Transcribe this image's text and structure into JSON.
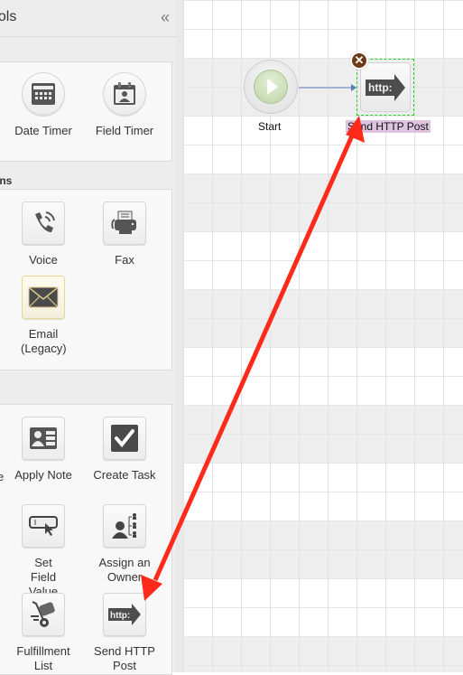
{
  "sidebar": {
    "title": "ools",
    "collapse_icon": "«",
    "sections": [
      {
        "heading": "",
        "tools": [
          {
            "label": "Date Timer",
            "icon": "calendar-icon"
          },
          {
            "label": "Field Timer",
            "icon": "contact-calendar-icon"
          }
        ]
      },
      {
        "heading": "ons",
        "tools": [
          {
            "label": "Voice",
            "icon": "phone-icon"
          },
          {
            "label": "Fax",
            "icon": "fax-icon"
          },
          {
            "label": "Email (Legacy)",
            "icon": "envelope-icon"
          }
        ]
      },
      {
        "heading": "",
        "cut_label": "e",
        "tools": [
          {
            "label": "Apply Note",
            "icon": "contact-card-icon"
          },
          {
            "label": "Create Task",
            "icon": "checkbox-icon"
          },
          {
            "label": "Set Field Value",
            "icon": "field-cursor-icon"
          },
          {
            "label": "Assign an Owner",
            "icon": "org-chart-person-icon"
          },
          {
            "label": "Fulfillment List",
            "icon": "hand-truck-icon"
          },
          {
            "label": "Send HTTP Post",
            "icon": "http-arrow-icon"
          }
        ]
      }
    ]
  },
  "canvas": {
    "nodes": [
      {
        "label": "Start",
        "type": "start"
      },
      {
        "label": "Send HTTP Post",
        "type": "http-post",
        "selected": true,
        "badge_text": "http:"
      }
    ],
    "close_glyph": "✕"
  },
  "colors": {
    "annotation_arrow": "#ff2a1a",
    "selection_outline": "#22d522",
    "connector": "#5a7bb5",
    "close_badge": "#6e3a17",
    "label_highlight": "#dfc4e0"
  }
}
